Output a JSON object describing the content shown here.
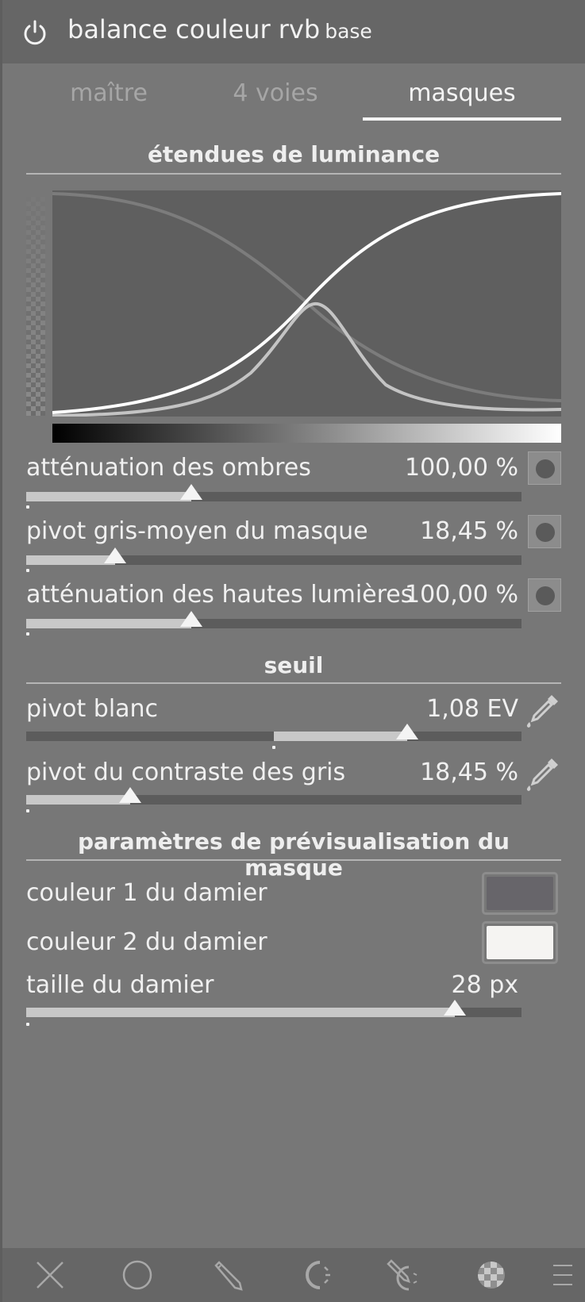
{
  "header": {
    "title": "balance couleur rvb",
    "subtitle": "base",
    "power_icon": "power-icon"
  },
  "tabs": [
    {
      "label": "maître",
      "active": false
    },
    {
      "label": "4 voies",
      "active": false
    },
    {
      "label": "masques",
      "active": true
    }
  ],
  "luminance_section": {
    "title": "étendues de luminance",
    "curves": [
      "shadows",
      "midtones",
      "highlights"
    ]
  },
  "luminance_sliders": [
    {
      "label": "atténuation des ombres",
      "value": "100,00 %",
      "fraction": 0.333
    },
    {
      "label": "pivot gris-moyen du masque",
      "value": "18,45 %",
      "fraction": 0.18
    },
    {
      "label": "atténuation des hautes lumières",
      "value": "100,00 %",
      "fraction": 0.333
    }
  ],
  "threshold_section": {
    "title": "seuil",
    "sliders": [
      {
        "label": "pivot blanc",
        "value": "1,08 EV",
        "fraction": 0.77,
        "origin": 0.5
      },
      {
        "label": "pivot du contraste des gris",
        "value": "18,45 %",
        "fraction": 0.21
      }
    ]
  },
  "preview_section": {
    "title": "paramètres de prévisualisation du masque",
    "checker_color_1": {
      "label": "couleur 1 du damier",
      "color": "#67656a"
    },
    "checker_color_2": {
      "label": "couleur 2 du damier",
      "color": "#f5f4f2"
    },
    "checker_size": {
      "label": "taille du damier",
      "value": "28 px",
      "fraction": 0.865
    }
  },
  "bottom_bar": {
    "icons": [
      "close-icon",
      "circle-mask-icon",
      "drawn-mask-icon",
      "parametric-mask-icon",
      "drawn-parametric-mask-icon",
      "raster-mask-icon",
      "menu-icon"
    ]
  },
  "colors": {
    "background": "#777777",
    "panel_header": "#666666",
    "graph_bg": "#5f5f5f",
    "accent": "#f4f4f4"
  }
}
